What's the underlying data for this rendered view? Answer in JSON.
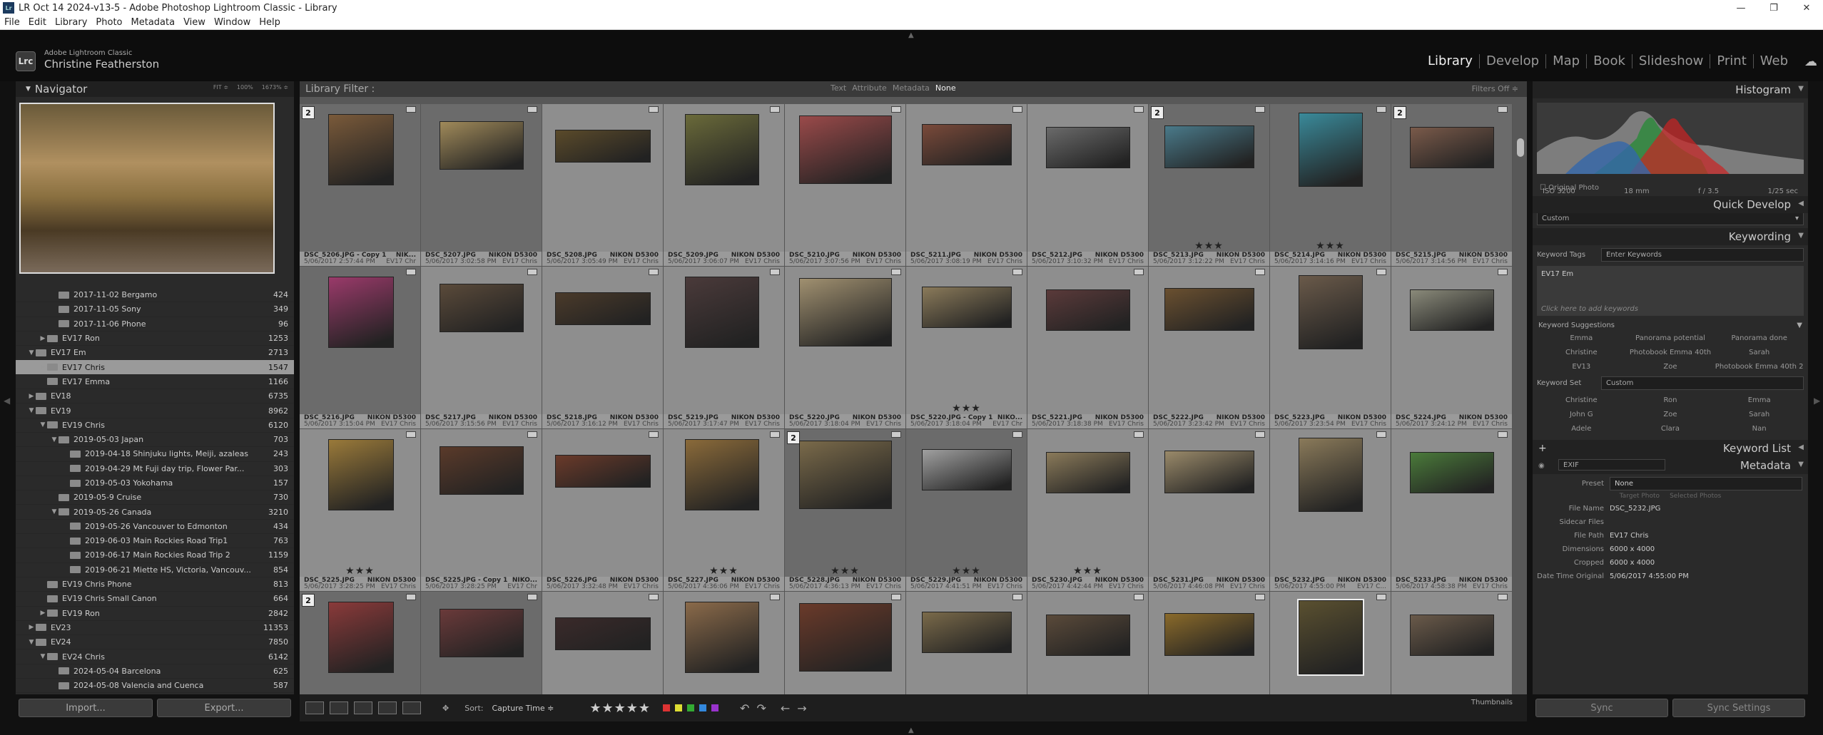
{
  "window": {
    "title": "LR Oct 14 2024-v13-5 - Adobe Photoshop Lightroom Classic - Library",
    "app_icon": "Lr",
    "min": "—",
    "max": "❐",
    "close": "✕"
  },
  "menu": [
    "File",
    "Edit",
    "Library",
    "Photo",
    "Metadata",
    "View",
    "Window",
    "Help"
  ],
  "identity": {
    "logo": "Lrc",
    "line1": "Adobe Lightroom Classic",
    "line2": "Christine Featherston"
  },
  "modules": [
    "Library",
    "Develop",
    "Map",
    "Book",
    "Slideshow",
    "Print",
    "Web"
  ],
  "active_module": "Library",
  "navigator": {
    "title": "Navigator",
    "zoom_opts": [
      "FIT ≑",
      "100%",
      "1673% ≑"
    ]
  },
  "folders": [
    {
      "label": "2017-11-02 Bergamo",
      "count": "424",
      "level": 3,
      "twist": ""
    },
    {
      "label": "2017-11-05 Sony",
      "count": "349",
      "level": 3,
      "twist": ""
    },
    {
      "label": "2017-11-06 Phone",
      "count": "96",
      "level": 3,
      "twist": ""
    },
    {
      "label": "EV17 Ron",
      "count": "1253",
      "level": 2,
      "twist": "▶"
    },
    {
      "label": "EV17 Em",
      "count": "2713",
      "level": 1,
      "twist": "▼"
    },
    {
      "label": "EV17 Chris",
      "count": "1547",
      "level": 2,
      "twist": "▶",
      "selected": true
    },
    {
      "label": "EV17 Emma",
      "count": "1166",
      "level": 2,
      "twist": ""
    },
    {
      "label": "EV18",
      "count": "6735",
      "level": 1,
      "twist": "▶"
    },
    {
      "label": "EV19",
      "count": "8962",
      "level": 1,
      "twist": "▼"
    },
    {
      "label": "EV19 Chris",
      "count": "6120",
      "level": 2,
      "twist": "▼"
    },
    {
      "label": "2019-05-03 Japan",
      "count": "703",
      "level": 3,
      "twist": "▼"
    },
    {
      "label": "2019-04-18 Shinjuku lights, Meiji, azaleas",
      "count": "243",
      "level": 4,
      "twist": ""
    },
    {
      "label": "2019-04-29 Mt Fuji day trip, Flower Par...",
      "count": "303",
      "level": 4,
      "twist": ""
    },
    {
      "label": "2019-05-03 Yokohama",
      "count": "157",
      "level": 4,
      "twist": ""
    },
    {
      "label": "2019-05-9 Cruise",
      "count": "730",
      "level": 3,
      "twist": ""
    },
    {
      "label": "2019-05-26 Canada",
      "count": "3210",
      "level": 3,
      "twist": "▼"
    },
    {
      "label": "2019-05-26 Vancouver to Edmonton",
      "count": "434",
      "level": 4,
      "twist": ""
    },
    {
      "label": "2019-06-03 Main Rockies Road Trip1",
      "count": "763",
      "level": 4,
      "twist": ""
    },
    {
      "label": "2019-06-17 Main Rockies Road Trip 2",
      "count": "1159",
      "level": 4,
      "twist": ""
    },
    {
      "label": "2019-06-21 Miette HS, Victoria, Vancouv...",
      "count": "854",
      "level": 4,
      "twist": ""
    },
    {
      "label": "EV19 Chris Phone",
      "count": "813",
      "level": 2,
      "twist": ""
    },
    {
      "label": "EV19 Chris Small Canon",
      "count": "664",
      "level": 2,
      "twist": ""
    },
    {
      "label": "EV19 Ron",
      "count": "2842",
      "level": 2,
      "twist": "▶"
    },
    {
      "label": "EV23",
      "count": "11353",
      "level": 1,
      "twist": "▶"
    },
    {
      "label": "EV24",
      "count": "7850",
      "level": 1,
      "twist": "▼"
    },
    {
      "label": "EV24 Chris",
      "count": "6142",
      "level": 2,
      "twist": "▼"
    },
    {
      "label": "2024-05-04 Barcelona",
      "count": "625",
      "level": 3,
      "twist": ""
    },
    {
      "label": "2024-05-08 Valencia and Cuenca",
      "count": "587",
      "level": 3,
      "twist": ""
    },
    {
      "label": "2024-05-12 Madrid",
      "count": "534",
      "level": 3,
      "twist": ""
    }
  ],
  "left_buttons": {
    "import": "Import...",
    "export": "Export..."
  },
  "filter": {
    "title": "Library Filter :",
    "options": [
      "Text",
      "Attribute",
      "Metadata",
      "None"
    ],
    "selected": "None",
    "preset": "Filters Off ≑"
  },
  "grid_captions": [
    {
      "name": "DSC_5206.JPG - Copy 1",
      "camera": "NIK...",
      "date": "5/06/2017 2:57:44 PM",
      "extra": "EV17 Chr"
    },
    {
      "name": "DSC_5207.JPG",
      "camera": "NIKON D5300",
      "date": "5/06/2017 3:02:58 PM",
      "extra": "EV17 Chris"
    },
    {
      "name": "DSC_5208.JPG",
      "camera": "NIKON D5300",
      "date": "5/06/2017 3:05:49 PM",
      "extra": "EV17 Chris"
    },
    {
      "name": "DSC_5209.JPG",
      "camera": "NIKON D5300",
      "date": "5/06/2017 3:06:07 PM",
      "extra": "EV17 Chris"
    },
    {
      "name": "DSC_5210.JPG",
      "camera": "NIKON D5300",
      "date": "5/06/2017 3:07:56 PM",
      "extra": "EV17 Chris"
    },
    {
      "name": "DSC_5211.JPG",
      "camera": "NIKON D5300",
      "date": "5/06/2017 3:08:19 PM",
      "extra": "EV17 Chris"
    },
    {
      "name": "DSC_5212.JPG",
      "camera": "NIKON D5300",
      "date": "5/06/2017 3:10:32 PM",
      "extra": "EV17 Chris"
    },
    {
      "name": "DSC_5213.JPG",
      "camera": "NIKON D5300",
      "date": "5/06/2017 3:12:22 PM",
      "extra": "EV17 Chris"
    },
    {
      "name": "DSC_5214.JPG",
      "camera": "NIKON D5300",
      "date": "5/06/2017 3:14:16 PM",
      "extra": "EV17 Chris"
    },
    {
      "name": "DSC_5215.JPG",
      "camera": "NIKON D5300",
      "date": "5/06/2017 3:14:56 PM",
      "extra": "EV17 Chris"
    },
    {
      "name": "DSC_5216.JPG",
      "camera": "NIKON D5300",
      "date": "5/06/2017 3:15:04 PM",
      "extra": "EV17 Chris"
    },
    {
      "name": "DSC_5217.JPG",
      "camera": "NIKON D5300",
      "date": "5/06/2017 3:15:56 PM",
      "extra": "EV17 Chris"
    },
    {
      "name": "DSC_5218.JPG",
      "camera": "NIKON D5300",
      "date": "5/06/2017 3:16:12 PM",
      "extra": "EV17 Chris"
    },
    {
      "name": "DSC_5219.JPG",
      "camera": "NIKON D5300",
      "date": "5/06/2017 3:17:47 PM",
      "extra": "EV17 Chris"
    },
    {
      "name": "DSC_5220.JPG",
      "camera": "NIKON D5300",
      "date": "5/06/2017 3:18:04 PM",
      "extra": "EV17 Chris"
    },
    {
      "name": "DSC_5220.JPG - Copy 1",
      "camera": "NIKO...",
      "date": "5/06/2017 3:18:04 PM",
      "extra": "EV17 Chr"
    },
    {
      "name": "DSC_5221.JPG",
      "camera": "NIKON D5300",
      "date": "5/06/2017 3:18:38 PM",
      "extra": "EV17 Chris"
    },
    {
      "name": "DSC_5222.JPG",
      "camera": "NIKON D5300",
      "date": "5/06/2017 3:23:42 PM",
      "extra": "EV17 Chris"
    },
    {
      "name": "DSC_5223.JPG",
      "camera": "NIKON D5300",
      "date": "5/06/2017 3:23:54 PM",
      "extra": "EV17 Chris"
    },
    {
      "name": "DSC_5224.JPG",
      "camera": "NIKON D5300",
      "date": "5/06/2017 3:24:12 PM",
      "extra": "EV17 Chris"
    },
    {
      "name": "DSC_5225.JPG",
      "camera": "NIKON D5300",
      "date": "5/06/2017 3:28:25 PM",
      "extra": "EV17 Chris"
    },
    {
      "name": "DSC_5225.JPG - Copy 1",
      "camera": "NIKO...",
      "date": "5/06/2017 3:28:25 PM",
      "extra": "EV17 Chr"
    },
    {
      "name": "DSC_5226.JPG",
      "camera": "NIKON D5300",
      "date": "5/06/2017 3:32:48 PM",
      "extra": "EV17 Chris"
    },
    {
      "name": "DSC_5227.JPG",
      "camera": "NIKON D5300",
      "date": "5/06/2017 4:36:06 PM",
      "extra": "EV17 Chris"
    },
    {
      "name": "DSC_5228.JPG",
      "camera": "NIKON D5300",
      "date": "5/06/2017 4:36:13 PM",
      "extra": "EV17 Chris"
    },
    {
      "name": "DSC_5229.JPG",
      "camera": "NIKON D5300",
      "date": "5/06/2017 4:41:51 PM",
      "extra": "EV17 Chris"
    },
    {
      "name": "DSC_5230.JPG",
      "camera": "NIKON D5300",
      "date": "5/06/2017 4:42:44 PM",
      "extra": "EV17 Chris"
    },
    {
      "name": "DSC_5231.JPG",
      "camera": "NIKON D5300",
      "date": "5/06/2017 4:46:08 PM",
      "extra": "EV17 Chris"
    },
    {
      "name": "DSC_5232.JPG",
      "camera": "NIKON D5300",
      "date": "5/06/2017 4:55:00 PM",
      "extra": "EV17 C..."
    },
    {
      "name": "DSC_5233.JPG",
      "camera": "NIKON D5300",
      "date": "5/06/2017 4:58:38 PM",
      "extra": "EV17 Chris"
    }
  ],
  "grid_cells": [
    {
      "stack": "2",
      "rating": "",
      "dark": true,
      "color": "#7a5a3a"
    },
    {
      "stack": "",
      "rating": "",
      "dark": true,
      "color": "#a08a5a"
    },
    {
      "stack": "",
      "rating": "",
      "dark": false,
      "color": "#5a4a2a"
    },
    {
      "stack": "",
      "rating": "",
      "dark": false,
      "color": "#6a6a3a"
    },
    {
      "stack": "",
      "rating": "",
      "dark": false,
      "color": "#9a4a4a"
    },
    {
      "stack": "",
      "rating": "",
      "dark": false,
      "color": "#7a4a3a"
    },
    {
      "stack": "",
      "rating": "",
      "dark": false,
      "color": "#6a6a6a"
    },
    {
      "stack": "2",
      "rating": "★★★",
      "dark": true,
      "color": "#4a7a8a"
    },
    {
      "stack": "",
      "rating": "★★★",
      "dark": true,
      "color": "#3a8a9a"
    },
    {
      "stack": "2",
      "rating": "",
      "dark": true,
      "color": "#7a5a4a"
    },
    {
      "stack": "",
      "rating": "",
      "dark": true,
      "color": "#9a3a6a"
    },
    {
      "stack": "",
      "rating": "",
      "dark": false,
      "color": "#5a4a3a"
    },
    {
      "stack": "",
      "rating": "",
      "dark": false,
      "color": "#4a3a2a"
    },
    {
      "stack": "",
      "rating": "",
      "dark": false,
      "color": "#4a3a3a"
    },
    {
      "stack": "",
      "rating": "",
      "dark": false,
      "color": "#a09070"
    },
    {
      "stack": "",
      "rating": "★★★",
      "dark": false,
      "color": "#8a7a5a"
    },
    {
      "stack": "",
      "rating": "",
      "dark": false,
      "color": "#5a3a3a"
    },
    {
      "stack": "",
      "rating": "",
      "dark": false,
      "color": "#6a5030"
    },
    {
      "stack": "",
      "rating": "",
      "dark": false,
      "color": "#6a5a4a"
    },
    {
      "stack": "",
      "rating": "",
      "dark": false,
      "color": "#8a8a7a"
    },
    {
      "stack": "",
      "rating": "★★★",
      "dark": false,
      "color": "#9a7a3a"
    },
    {
      "stack": "",
      "rating": "",
      "dark": false,
      "color": "#5a3a2a"
    },
    {
      "stack": "",
      "rating": "",
      "dark": false,
      "color": "#6a3a2a"
    },
    {
      "stack": "",
      "rating": "★★★",
      "dark": false,
      "color": "#8a6a3a"
    },
    {
      "stack": "2",
      "rating": "★★★",
      "dark": true,
      "color": "#7a6a4a"
    },
    {
      "stack": "",
      "rating": "★★★",
      "dark": true,
      "color": "#a0a0a0"
    },
    {
      "stack": "",
      "rating": "★★★",
      "dark": false,
      "color": "#8a7a5a"
    },
    {
      "stack": "",
      "rating": "",
      "dark": false,
      "color": "#9a8a6a"
    },
    {
      "stack": "",
      "rating": "",
      "dark": false,
      "color": "#8a7a5a"
    },
    {
      "stack": "",
      "rating": "",
      "dark": false,
      "color": "#4a7a3a"
    },
    {
      "stack": "2",
      "rating": "",
      "dark": true,
      "color": "#8a3a3a"
    },
    {
      "stack": "",
      "rating": "",
      "dark": true,
      "color": "#6a3a3a"
    },
    {
      "stack": "",
      "rating": "",
      "dark": false,
      "color": "#3a2a2a"
    },
    {
      "stack": "",
      "rating": "",
      "dark": false,
      "color": "#8a6a4a"
    },
    {
      "stack": "",
      "rating": "",
      "dark": false,
      "color": "#6a3a2a"
    },
    {
      "stack": "",
      "rating": "",
      "dark": false,
      "color": "#7a6a4a"
    },
    {
      "stack": "",
      "rating": "",
      "dark": false,
      "color": "#5a4a3a"
    },
    {
      "stack": "",
      "rating": "",
      "dark": false,
      "color": "#8a6a2a"
    },
    {
      "stack": "",
      "rating": "",
      "dark": false,
      "color": "#5a5030",
      "selected": true
    },
    {
      "stack": "",
      "rating": "",
      "dark": false,
      "color": "#6a5a4a"
    }
  ],
  "toolbar": {
    "sort_label": "Sort:",
    "sort_value": "Capture Time ≑",
    "stars": "★★★★★",
    "thumbs": "Thumbnails",
    "label_colors": [
      "#d33",
      "#dd3",
      "#3a3",
      "#38d",
      "#93c"
    ]
  },
  "right": {
    "histogram": "Histogram",
    "hist_info": [
      "ISO 3200",
      "18 mm",
      "f / 3.5",
      "1/25 sec"
    ],
    "original_photo": "Original Photo",
    "quick_develop": "Quick Develop",
    "saved_preset": "Custom",
    "keywording": "Keywording",
    "keyword_tags_label": "Keyword Tags",
    "keyword_tags_value": "Enter Keywords",
    "keyword_text": "EV17 Em",
    "click_to_add": "Click here to add keywords",
    "suggestions_label": "Keyword Suggestions",
    "suggestions": [
      "Emma",
      "Panorama potential",
      "Panorama done",
      "Christine",
      "Photobook Emma 40th",
      "Sarah",
      "EV13",
      "Zoe",
      "Photobook Emma 40th 2"
    ],
    "keyword_set_label": "Keyword Set",
    "keyword_set_value": "Custom",
    "keyword_set": [
      "Christine",
      "Ron",
      "Emma",
      "John G",
      "Zoe",
      "Sarah",
      "Adele",
      "Clara",
      "Nan"
    ],
    "keyword_list": "Keyword List",
    "metadata": "Metadata",
    "meta_preset_view": "EXIF",
    "preset_label": "Preset",
    "preset_value": "None",
    "target_photo": "Target Photo",
    "selected_photos": "Selected Photos",
    "meta_rows": [
      {
        "k": "File Name",
        "v": "DSC_5232.JPG"
      },
      {
        "k": "Sidecar Files",
        "v": ""
      },
      {
        "k": "File Path",
        "v": "EV17 Chris"
      },
      {
        "k": "Dimensions",
        "v": "6000 x 4000"
      },
      {
        "k": "Cropped",
        "v": "6000 x 4000"
      },
      {
        "k": "Date Time Original",
        "v": "5/06/2017 4:55:00 PM"
      }
    ],
    "sync": "Sync",
    "sync_settings": "Sync Settings"
  }
}
